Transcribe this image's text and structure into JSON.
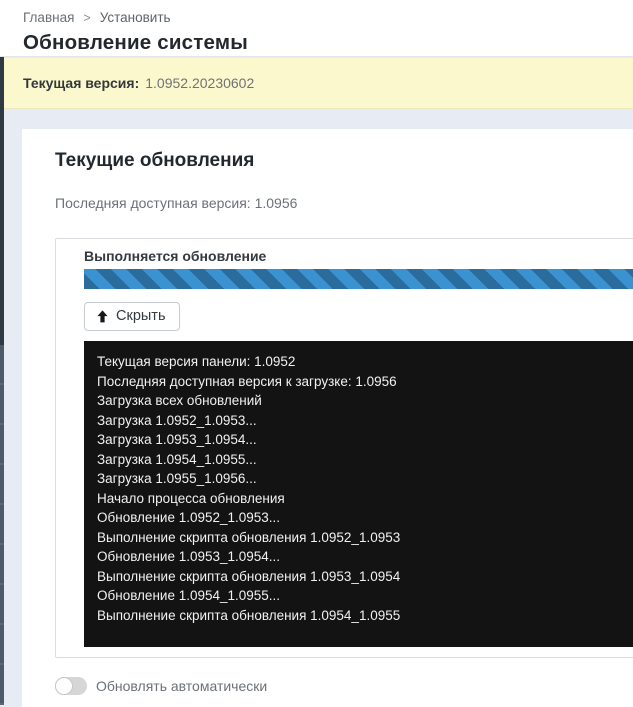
{
  "breadcrumb": {
    "home": "Главная",
    "separator": ">",
    "current": "Установить"
  },
  "page": {
    "title": "Обновление системы"
  },
  "alert": {
    "label": "Текущая версия:",
    "value": "1.0952.20230602",
    "background": "#fcf8cd"
  },
  "card": {
    "title": "Текущие обновления",
    "latest_version_text": "Последняя доступная версия: 1.0956"
  },
  "update_panel": {
    "status_label": "Выполняется обновление",
    "progress": {
      "style": "diagonal-striped",
      "percent": 100,
      "color_light": "#3a92d0",
      "color_dark": "#2a6d9d"
    },
    "hide_button": {
      "icon": "arrow-up-icon",
      "label": "Скрыть"
    },
    "console": {
      "background": "#131313",
      "text_color": "#f1f1f1",
      "lines": [
        "Текущая версия панели: 1.0952",
        "Последняя доступная версия к загрузке: 1.0956",
        "Загрузка всех обновлений",
        "Загрузка 1.0952_1.0953...",
        "Загрузка 1.0953_1.0954...",
        "Загрузка 1.0954_1.0955...",
        "Загрузка 1.0955_1.0956...",
        "Начало процесса обновления",
        "Обновление 1.0952_1.0953...",
        "Выполнение скрипта обновления 1.0952_1.0953",
        "Обновление 1.0953_1.0954...",
        "Выполнение скрипта обновления 1.0953_1.0954",
        "Обновление 1.0954_1.0955...",
        "Выполнение скрипта обновления 1.0954_1.0955"
      ]
    }
  },
  "auto_update_toggle": {
    "label": "Обновлять автоматически",
    "state": "off"
  }
}
